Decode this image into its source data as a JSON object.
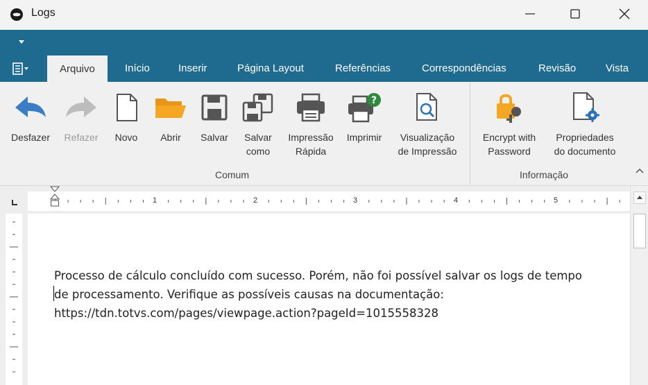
{
  "window": {
    "title": "Logs"
  },
  "tabs": [
    {
      "label": "Arquivo",
      "active": true
    },
    {
      "label": "Início"
    },
    {
      "label": "Inserir"
    },
    {
      "label": "Página Layout"
    },
    {
      "label": "Referências"
    },
    {
      "label": "Correspondências"
    },
    {
      "label": "Revisão"
    },
    {
      "label": "Vista"
    }
  ],
  "ribbon": {
    "comum": {
      "label": "Comum",
      "buttons": [
        {
          "label": "Desfazer",
          "icon": "undo-arrow-icon",
          "enabled": true
        },
        {
          "label": "Refazer",
          "icon": "redo-arrow-icon",
          "enabled": false
        },
        {
          "label": "Novo",
          "icon": "new-document-icon",
          "enabled": true
        },
        {
          "label": "Abrir",
          "icon": "open-folder-icon",
          "enabled": true
        },
        {
          "label": "Salvar",
          "icon": "save-disk-icon",
          "enabled": true
        },
        {
          "label": "Salvar\ncomo",
          "icon": "save-as-icon",
          "enabled": true
        },
        {
          "label": "Impressão\nRápida",
          "icon": "quick-print-icon",
          "enabled": true
        },
        {
          "label": "Imprimir",
          "icon": "print-icon",
          "enabled": true
        },
        {
          "label": "Visualização\nde Impressão",
          "icon": "print-preview-icon",
          "enabled": true
        }
      ]
    },
    "informacao": {
      "label": "Informação",
      "buttons": [
        {
          "label": "Encrypt with\nPassword",
          "icon": "lock-key-icon",
          "enabled": true
        },
        {
          "label": "Propriedades\ndo documento",
          "icon": "document-properties-icon",
          "enabled": true
        }
      ]
    }
  },
  "ruler": {
    "numbers": [
      "1",
      "2",
      "3",
      "4",
      "5"
    ]
  },
  "document": {
    "lines": [
      "Processo de cálculo concluído com sucesso. Porém, não foi possível salvar os logs de tempo",
      "de processamento. Verifique as possíveis causas na documentação:",
      "https://tdn.totvs.com/pages/viewpage.action?pageId=1015558328"
    ]
  },
  "colors": {
    "ribbon_blue": "#1e6b8f",
    "ribbon_bg": "#f0f0f0",
    "undo_blue": "#3b7dc4",
    "folder_orange": "#f5a623",
    "help_green": "#2e8b3e",
    "gear_blue": "#2a72b8"
  }
}
